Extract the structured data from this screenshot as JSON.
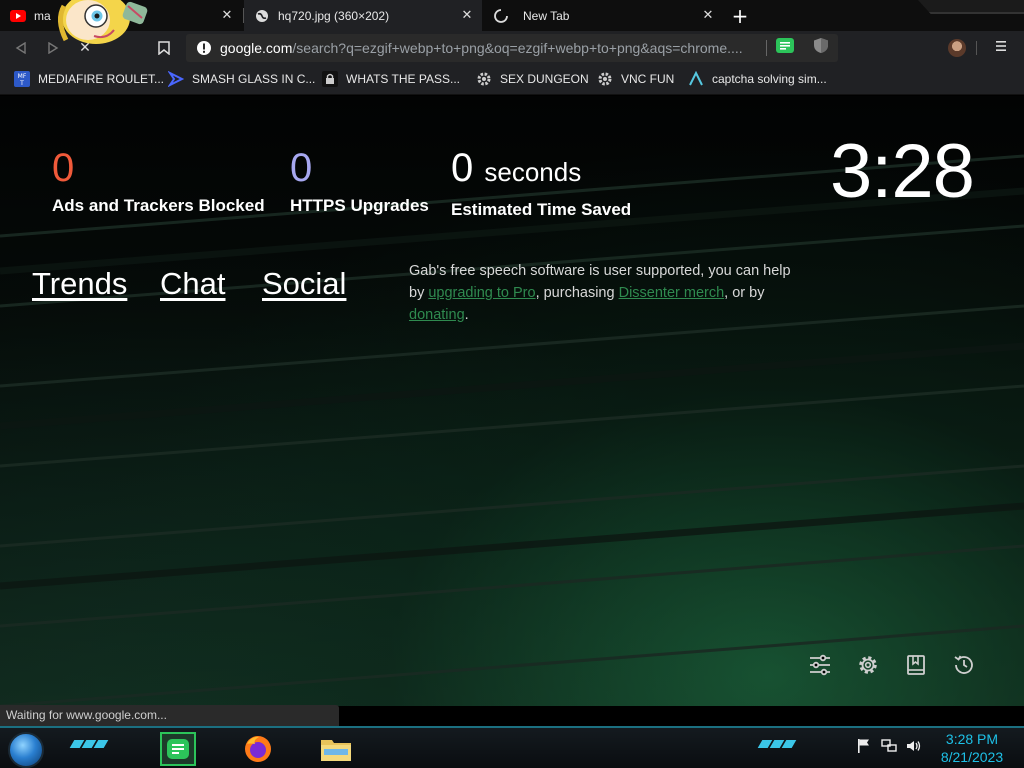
{
  "tabs": [
    {
      "title": "ma",
      "icon": "youtube-icon",
      "active": false
    },
    {
      "title": "hq720.jpg (360×202)",
      "icon": "globe-icon",
      "active": true
    },
    {
      "title": "New Tab",
      "icon": "loading-icon",
      "active": false
    }
  ],
  "toolbar": {
    "url_host": "google.com",
    "url_path": "/search?q=ezgif+webp+to+png&oq=ezgif+webp+to+png&aqs=chrome...."
  },
  "bookmarks": [
    {
      "label": "MEDIAFIRE ROULET...",
      "icon": "mediafire-icon"
    },
    {
      "label": "SMASH GLASS IN C...",
      "icon": "smash-icon"
    },
    {
      "label": "WHATS THE PASS...",
      "icon": "lock-icon"
    },
    {
      "label": "SEX DUNGEON",
      "icon": "gear-icon"
    },
    {
      "label": "VNC FUN",
      "icon": "gear-icon"
    },
    {
      "label": "captcha solving sim...",
      "icon": "arrow-icon"
    }
  ],
  "stats": {
    "ads": {
      "value": "0",
      "label": "Ads and Trackers Blocked",
      "color": "#f05a3a"
    },
    "https": {
      "value": "0",
      "label": "HTTPS Upgrades",
      "color": "#a7a8f0"
    },
    "time": {
      "value": "0",
      "unit": "seconds",
      "label": "Estimated Time Saved",
      "color": "#ffffff"
    }
  },
  "clock": "3:28",
  "nav_links": [
    "Trends",
    "Chat",
    "Social"
  ],
  "gab": {
    "t1": "Gab's free speech software is user supported, you can help by ",
    "link1": "upgrading to Pro",
    "t2": ", purchasing ",
    "link2": "Dissenter merch",
    "t3": ", or by ",
    "link3": "donating",
    "t4": "."
  },
  "status": "Waiting for www.google.com...",
  "taskbar": {
    "time": "3:28 PM",
    "date": "8/21/2023",
    "accent": "#1ec0e6"
  }
}
